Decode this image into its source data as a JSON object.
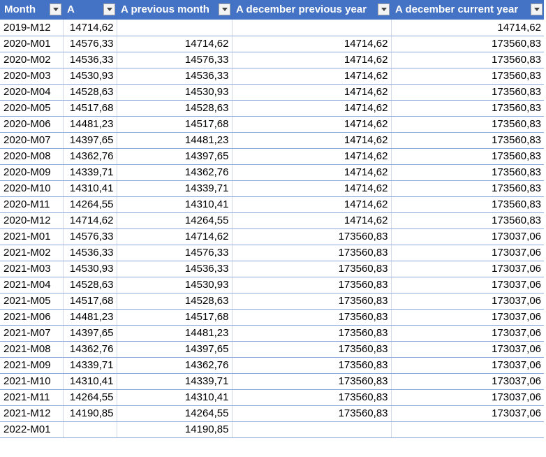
{
  "headers": [
    "Month",
    "A",
    "A previous month",
    "A december previous year",
    "A december current year"
  ],
  "rows": [
    [
      "2019-M12",
      "14714,62",
      "",
      "",
      "14714,62"
    ],
    [
      "2020-M01",
      "14576,33",
      "14714,62",
      "14714,62",
      "173560,83"
    ],
    [
      "2020-M02",
      "14536,33",
      "14576,33",
      "14714,62",
      "173560,83"
    ],
    [
      "2020-M03",
      "14530,93",
      "14536,33",
      "14714,62",
      "173560,83"
    ],
    [
      "2020-M04",
      "14528,63",
      "14530,93",
      "14714,62",
      "173560,83"
    ],
    [
      "2020-M05",
      "14517,68",
      "14528,63",
      "14714,62",
      "173560,83"
    ],
    [
      "2020-M06",
      "14481,23",
      "14517,68",
      "14714,62",
      "173560,83"
    ],
    [
      "2020-M07",
      "14397,65",
      "14481,23",
      "14714,62",
      "173560,83"
    ],
    [
      "2020-M08",
      "14362,76",
      "14397,65",
      "14714,62",
      "173560,83"
    ],
    [
      "2020-M09",
      "14339,71",
      "14362,76",
      "14714,62",
      "173560,83"
    ],
    [
      "2020-M10",
      "14310,41",
      "14339,71",
      "14714,62",
      "173560,83"
    ],
    [
      "2020-M11",
      "14264,55",
      "14310,41",
      "14714,62",
      "173560,83"
    ],
    [
      "2020-M12",
      "14714,62",
      "14264,55",
      "14714,62",
      "173560,83"
    ],
    [
      "2021-M01",
      "14576,33",
      "14714,62",
      "173560,83",
      "173037,06"
    ],
    [
      "2021-M02",
      "14536,33",
      "14576,33",
      "173560,83",
      "173037,06"
    ],
    [
      "2021-M03",
      "14530,93",
      "14536,33",
      "173560,83",
      "173037,06"
    ],
    [
      "2021-M04",
      "14528,63",
      "14530,93",
      "173560,83",
      "173037,06"
    ],
    [
      "2021-M05",
      "14517,68",
      "14528,63",
      "173560,83",
      "173037,06"
    ],
    [
      "2021-M06",
      "14481,23",
      "14517,68",
      "173560,83",
      "173037,06"
    ],
    [
      "2021-M07",
      "14397,65",
      "14481,23",
      "173560,83",
      "173037,06"
    ],
    [
      "2021-M08",
      "14362,76",
      "14397,65",
      "173560,83",
      "173037,06"
    ],
    [
      "2021-M09",
      "14339,71",
      "14362,76",
      "173560,83",
      "173037,06"
    ],
    [
      "2021-M10",
      "14310,41",
      "14339,71",
      "173560,83",
      "173037,06"
    ],
    [
      "2021-M11",
      "14264,55",
      "14310,41",
      "173560,83",
      "173037,06"
    ],
    [
      "2021-M12",
      "14190,85",
      "14264,55",
      "173560,83",
      "173037,06"
    ],
    [
      "2022-M01",
      "",
      "14190,85",
      "",
      ""
    ]
  ],
  "colors": {
    "header_bg": "#4472c4",
    "header_text": "#ffffff",
    "row_border": "#8ea9db",
    "grid_line": "#d0d7e5"
  },
  "icons": {
    "filter": "filter-dropdown-icon"
  }
}
